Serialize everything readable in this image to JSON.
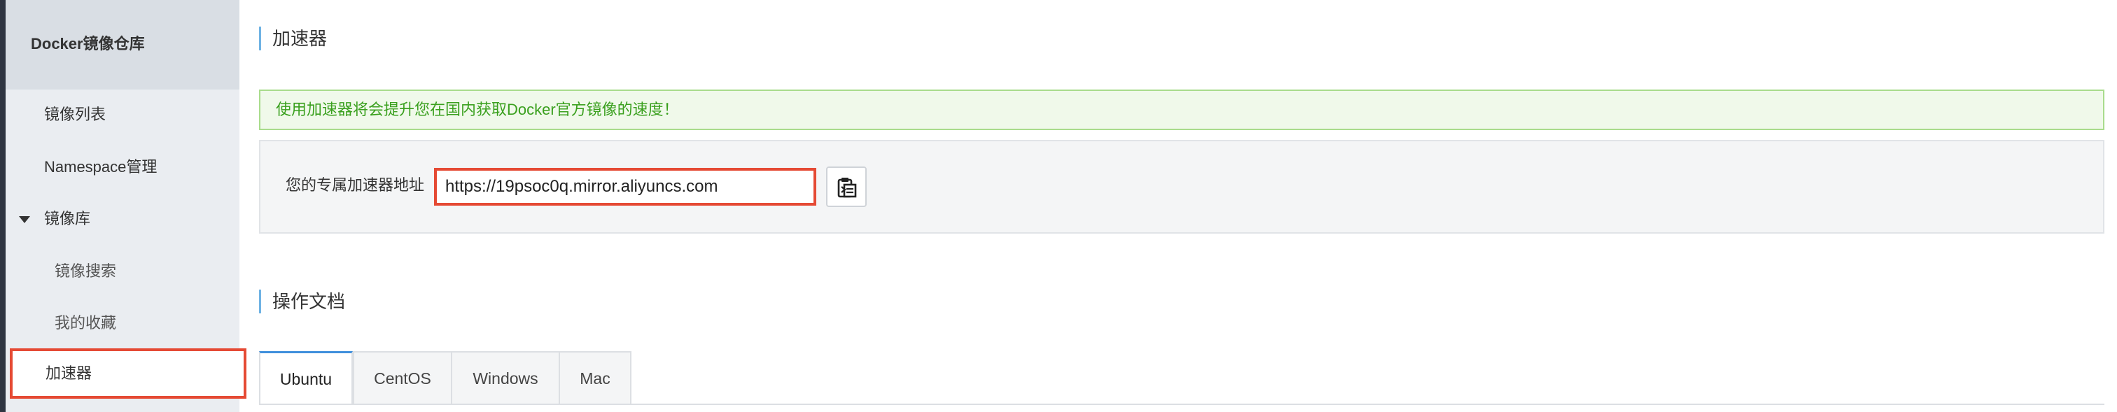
{
  "sidebar": {
    "title": "Docker镜像仓库",
    "items": [
      {
        "label": "镜像列表",
        "active": false
      },
      {
        "label": "Namespace管理",
        "active": false
      },
      {
        "label": "镜像库",
        "active": false,
        "expanded": true
      },
      {
        "label": "镜像搜索",
        "active": false
      },
      {
        "label": "我的收藏",
        "active": false
      },
      {
        "label": "加速器",
        "active": true
      }
    ]
  },
  "accelerator": {
    "heading": "加速器",
    "notice": "使用加速器将会提升您在国内获取Docker官方镜像的速度！",
    "address_label": "您的专属加速器地址",
    "address_value": "https://19psoc0q.mirror.aliyuncs.com",
    "copy_icon": "clipboard-icon"
  },
  "docs": {
    "heading": "操作文档",
    "tabs": [
      {
        "label": "Ubuntu",
        "active": true
      },
      {
        "label": "CentOS",
        "active": false
      },
      {
        "label": "Windows",
        "active": false
      },
      {
        "label": "Mac",
        "active": false
      }
    ]
  },
  "colors": {
    "sidebar_bg": "#eaedf1",
    "highlight_red": "#e54a34",
    "accent_blue": "#3f8fdc",
    "notice_green": "#3aa01e"
  }
}
